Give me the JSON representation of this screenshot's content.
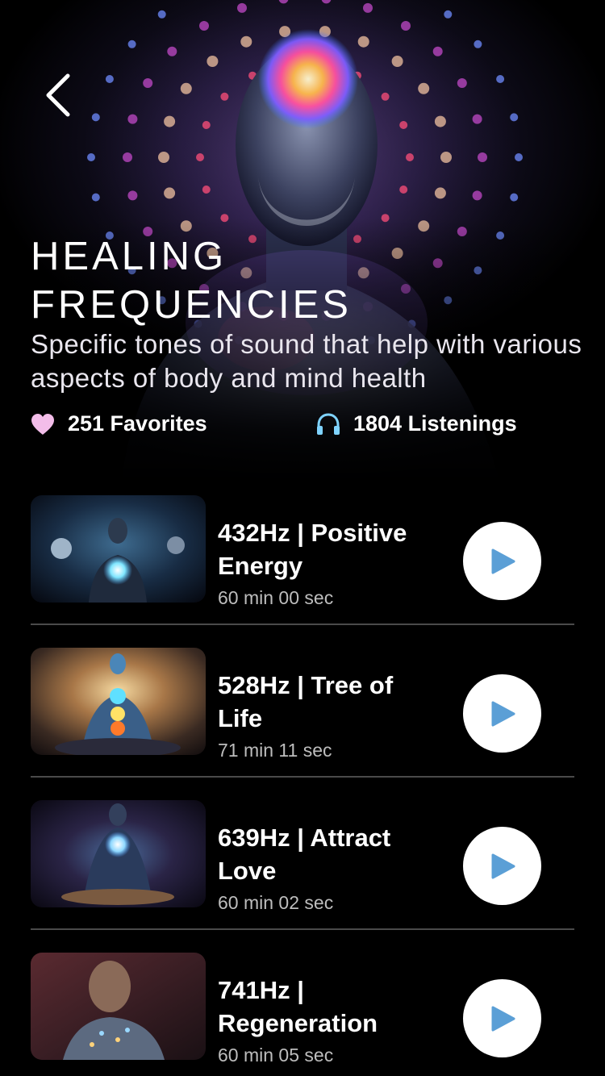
{
  "header": {
    "title_line1": "HEALING",
    "title_line2": "FREQUENCIES",
    "subtitle": "Specific tones of sound that help with various aspects of body and mind health",
    "back_icon": "chevron-left-icon"
  },
  "stats": {
    "favorites_icon": "heart-icon",
    "favorites": "251 Favorites",
    "listenings_icon": "headphones-icon",
    "listenings": "1804 Listenings"
  },
  "tracks": [
    {
      "title": "432Hz | Positive Energy",
      "duration": "60 min 00 sec"
    },
    {
      "title": "528Hz | Tree of Life",
      "duration": "71 min 11 sec"
    },
    {
      "title": "639Hz | Attract Love",
      "duration": "60 min 02 sec"
    },
    {
      "title": "741Hz | Regeneration",
      "duration": "60 min 05 sec"
    }
  ],
  "colors": {
    "background": "#000000",
    "heart": "#f3bde9",
    "headphones": "#7fd3ff",
    "play_triangle": "#5b9fd6",
    "duration_text": "#bdbdbd",
    "divider": "#4a4a4a"
  }
}
